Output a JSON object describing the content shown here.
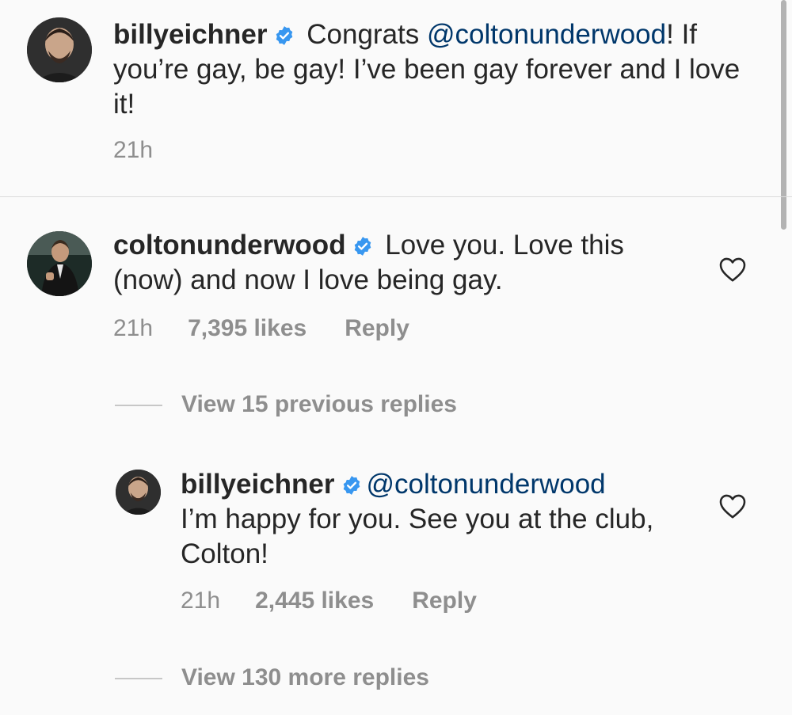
{
  "comments": [
    {
      "username": "billyeichner",
      "verified": true,
      "text_pre": " Congrats ",
      "mention": "@coltonunderwood",
      "text_post": "! If you’re gay, be gay! I’ve been gay forever and I love it!",
      "time": "21h"
    },
    {
      "username": "coltonunderwood",
      "verified": true,
      "text": " Love you. Love this (now) and now I love being gay.",
      "time": "21h",
      "likes": "7,395 likes",
      "reply_label": "Reply"
    }
  ],
  "view_previous_replies": "View 15 previous replies",
  "reply": {
    "username": "billyeichner",
    "verified": true,
    "mention": "@coltonunderwood",
    "text": "I’m happy for you. See you at the club, Colton!",
    "time": "21h",
    "likes": "2,445 likes",
    "reply_label": "Reply"
  },
  "view_more_replies": "View 130 more replies",
  "icons": {
    "verified": "verified-badge-icon",
    "heart": "heart-outline-icon"
  },
  "colors": {
    "background": "#fafafa",
    "text": "#262626",
    "secondary": "#8e8e8e",
    "mention": "#00376b",
    "verified": "#3897f0"
  }
}
